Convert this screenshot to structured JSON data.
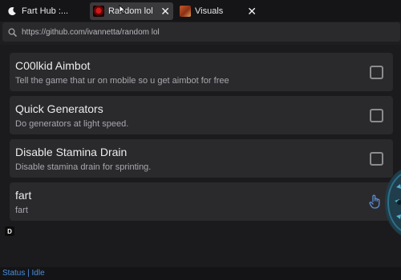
{
  "tabs": [
    {
      "label": "Fart Hub :...",
      "icon": "moon-icon",
      "active": false
    },
    {
      "label": "Random lol",
      "icon": "red-thumbnail",
      "active": true,
      "close": "✕"
    },
    {
      "label": "Visuals",
      "icon": "visuals-thumbnail",
      "active": false,
      "close": "✕"
    }
  ],
  "address": {
    "url": "https://github.com/ivannetta/random lol",
    "icon": "search-icon"
  },
  "items": [
    {
      "title": "C00lkid Aimbot",
      "description": "Tell the game that ur on mobile so u get aimbot for free",
      "control": "checkbox"
    },
    {
      "title": "Quick Generators",
      "description": "Do generators at light speed.",
      "control": "checkbox"
    },
    {
      "title": "Disable Stamina Drain",
      "description": "Disable stamina drain for sprinting.",
      "control": "checkbox"
    },
    {
      "title": "fart",
      "description": "fart",
      "control": "button"
    }
  ],
  "badge": "D",
  "status": "Status | Idle",
  "colors": {
    "accent": "#4a8fe0",
    "row_bg": "#2a2a2d",
    "bg": "#1b1b1d"
  }
}
